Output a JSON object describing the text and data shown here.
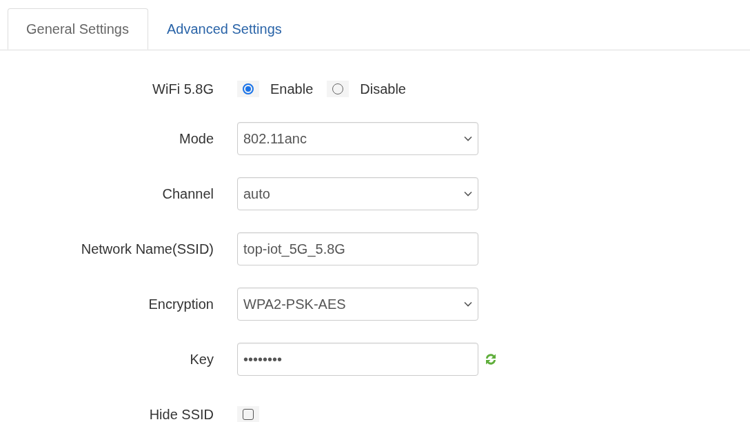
{
  "tabs": [
    {
      "label": "General Settings",
      "selected": true
    },
    {
      "label": "Advanced Settings",
      "selected": false
    }
  ],
  "fields": [
    {
      "label": "WiFi 5.8G",
      "kind": "radio",
      "options": [
        {
          "label": "Enable",
          "selected": true
        },
        {
          "label": "Disable",
          "selected": false
        }
      ]
    },
    {
      "label": "Mode",
      "kind": "select",
      "value": "802.11anc"
    },
    {
      "label": "Channel",
      "kind": "select",
      "value": "auto"
    },
    {
      "label": "Network Name(SSID)",
      "kind": "text",
      "value": "top-iot_5G_5.8G"
    },
    {
      "label": "Encryption",
      "kind": "select",
      "value": "WPA2-PSK-AES"
    },
    {
      "label": "Key",
      "kind": "password",
      "value": "••••••••"
    },
    {
      "label": "Hide SSID",
      "kind": "checkbox",
      "checked": false
    }
  ]
}
